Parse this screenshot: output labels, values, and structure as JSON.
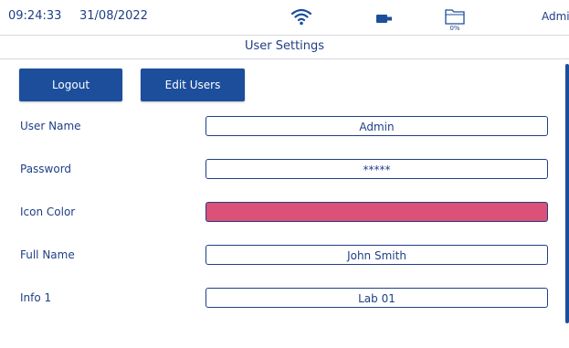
{
  "status": {
    "time": "09:24:33",
    "date": "31/08/2022",
    "storage_percent": "0%",
    "user": "Admin",
    "icons": [
      "wifi-icon",
      "usb-icon",
      "folder-icon"
    ]
  },
  "title": "User Settings",
  "buttons": {
    "logout": "Logout",
    "edit_users": "Edit Users"
  },
  "form": {
    "user_name": {
      "label": "User Name",
      "value": "Admin"
    },
    "password": {
      "label": "Password",
      "value": "*****"
    },
    "icon_color": {
      "label": "Icon Color",
      "value": "#db5177"
    },
    "full_name": {
      "label": "Full Name",
      "value": "John Smith"
    },
    "info1": {
      "label": "Info 1",
      "value": "Lab 01"
    }
  },
  "colors": {
    "accent": "#1c4e9c",
    "text": "#1f3f86",
    "icon_color": "#db5177"
  }
}
